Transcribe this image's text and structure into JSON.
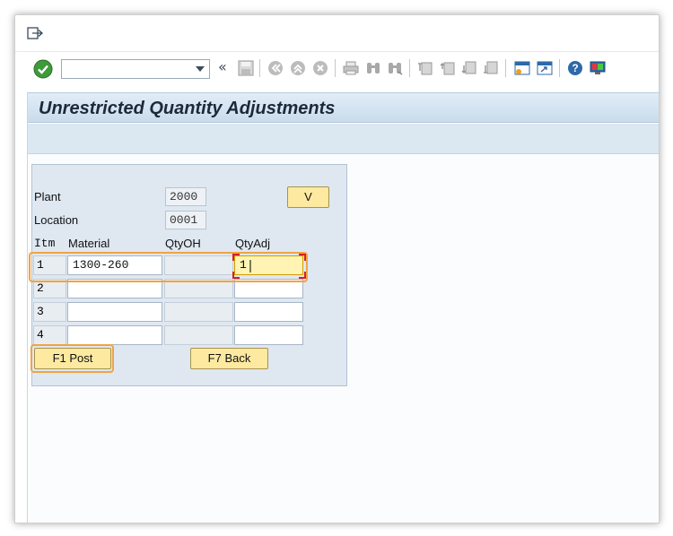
{
  "window": {
    "title": "Unrestricted Quantity Adjustments"
  },
  "menubar": {
    "exit_icon": "exit-menu-icon"
  },
  "toolbar": {
    "command_field_value": "",
    "icons": [
      "check-icon",
      "history-back-icon",
      "save-icon",
      "back-icon",
      "exit-icon",
      "cancel-icon",
      "print-icon",
      "find-icon",
      "find-next-icon",
      "first-page-icon",
      "previous-page-icon",
      "next-page-icon",
      "last-page-icon",
      "new-session-icon",
      "shortcut-icon",
      "help-icon",
      "customize-layout-icon"
    ]
  },
  "form": {
    "plant_label": "Plant",
    "plant_value": "2000",
    "location_label": "Location",
    "location_value": "0001",
    "v_button": "V",
    "columns": {
      "itm": "Itm",
      "material": "Material",
      "qtyoh": "QtyOH",
      "qtyadj": "QtyAdj"
    },
    "rows": [
      {
        "itm": "1",
        "material": "1300-260",
        "qtyoh": "",
        "qtyadj": "1"
      },
      {
        "itm": "2",
        "material": "",
        "qtyoh": "",
        "qtyadj": ""
      },
      {
        "itm": "3",
        "material": "",
        "qtyoh": "",
        "qtyadj": ""
      },
      {
        "itm": "4",
        "material": "",
        "qtyoh": "",
        "qtyadj": ""
      }
    ],
    "post_button": "F1 Post",
    "back_button": "F7 Back"
  },
  "colors": {
    "highlight": "#f2a341",
    "button_fill": "#fde9a0",
    "title_bar": "#c9dcec",
    "panel": "#dfe8f1"
  }
}
